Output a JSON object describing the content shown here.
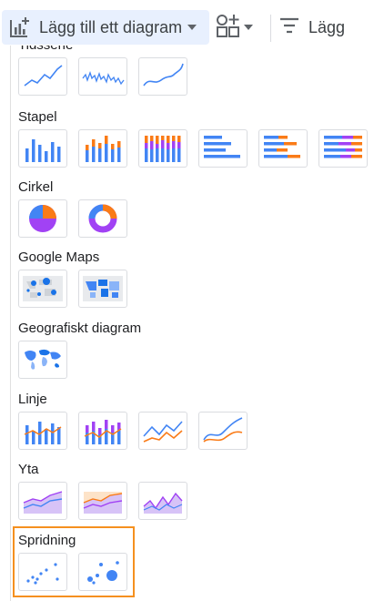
{
  "toolbar": {
    "add_chart_label": "Lägg till ett diagram",
    "add_control_icon": "add-control-icon",
    "filter_label": "Lägg"
  },
  "colors": {
    "blue": "#4285f4",
    "orange": "#fa7b17",
    "purple": "#a142f4",
    "light_purple": "#d7c3f7",
    "highlight": "#f5901f"
  },
  "sections": {
    "timeseries": {
      "title": "Tidsserie"
    },
    "bar": {
      "title": "Stapel"
    },
    "pie": {
      "title": "Cirkel"
    },
    "google_maps": {
      "title": "Google Maps"
    },
    "geo": {
      "title": "Geografiskt diagram"
    },
    "combo": {
      "title": "Linje"
    },
    "area": {
      "title": "Yta"
    },
    "scatter": {
      "title": "Spridning"
    }
  }
}
